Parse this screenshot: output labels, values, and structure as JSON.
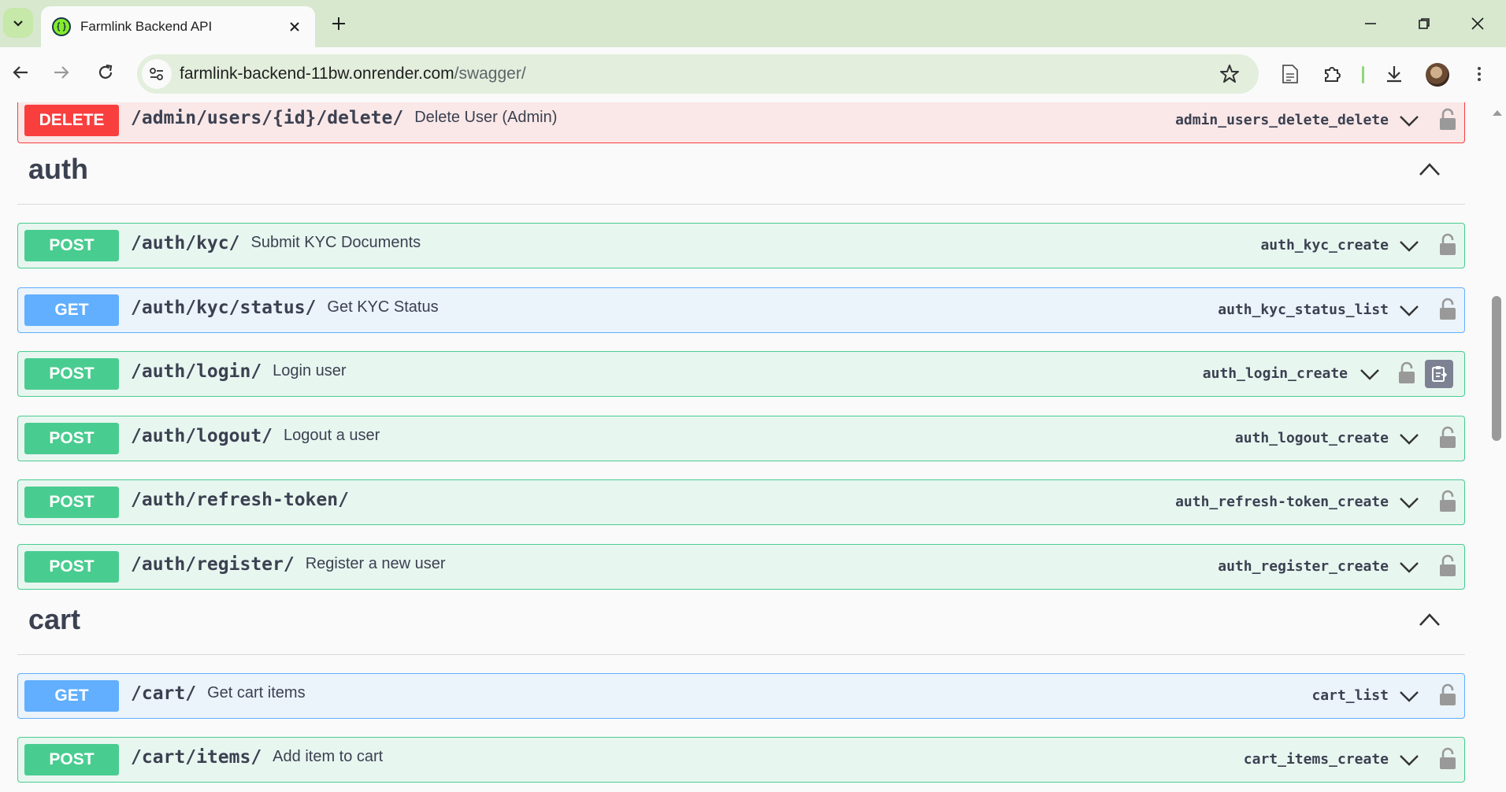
{
  "browser": {
    "tab_title": "Farmlink Backend API",
    "url_host": "farmlink-backend-11bw.onrender.com",
    "url_path": "/swagger/"
  },
  "top_partial": {
    "method": "DELETE",
    "path": "/admin/users/{id}/delete/",
    "summary": "Delete User (Admin)",
    "operation_id": "admin_users_delete_delete"
  },
  "sections": [
    {
      "name": "auth",
      "operations": [
        {
          "method": "POST",
          "path": "/auth/kyc/",
          "summary": "Submit KYC Documents",
          "operation_id": "auth_kyc_create"
        },
        {
          "method": "GET",
          "path": "/auth/kyc/status/",
          "summary": "Get KYC Status",
          "operation_id": "auth_kyc_status_list"
        },
        {
          "method": "POST",
          "path": "/auth/login/",
          "summary": "Login user",
          "operation_id": "auth_login_create"
        },
        {
          "method": "POST",
          "path": "/auth/logout/",
          "summary": "Logout a user",
          "operation_id": "auth_logout_create"
        },
        {
          "method": "POST",
          "path": "/auth/refresh-token/",
          "summary": "",
          "operation_id": "auth_refresh-token_create"
        },
        {
          "method": "POST",
          "path": "/auth/register/",
          "summary": "Register a new user",
          "operation_id": "auth_register_create"
        }
      ]
    },
    {
      "name": "cart",
      "operations": [
        {
          "method": "GET",
          "path": "/cart/",
          "summary": "Get cart items",
          "operation_id": "cart_list"
        },
        {
          "method": "POST",
          "path": "/cart/items/",
          "summary": "Add item to cart",
          "operation_id": "cart_items_create"
        }
      ]
    }
  ],
  "icons": {
    "lock": "lock-icon",
    "chevron": "chevron-down-icon",
    "copy": "clipboard-copy-icon"
  }
}
